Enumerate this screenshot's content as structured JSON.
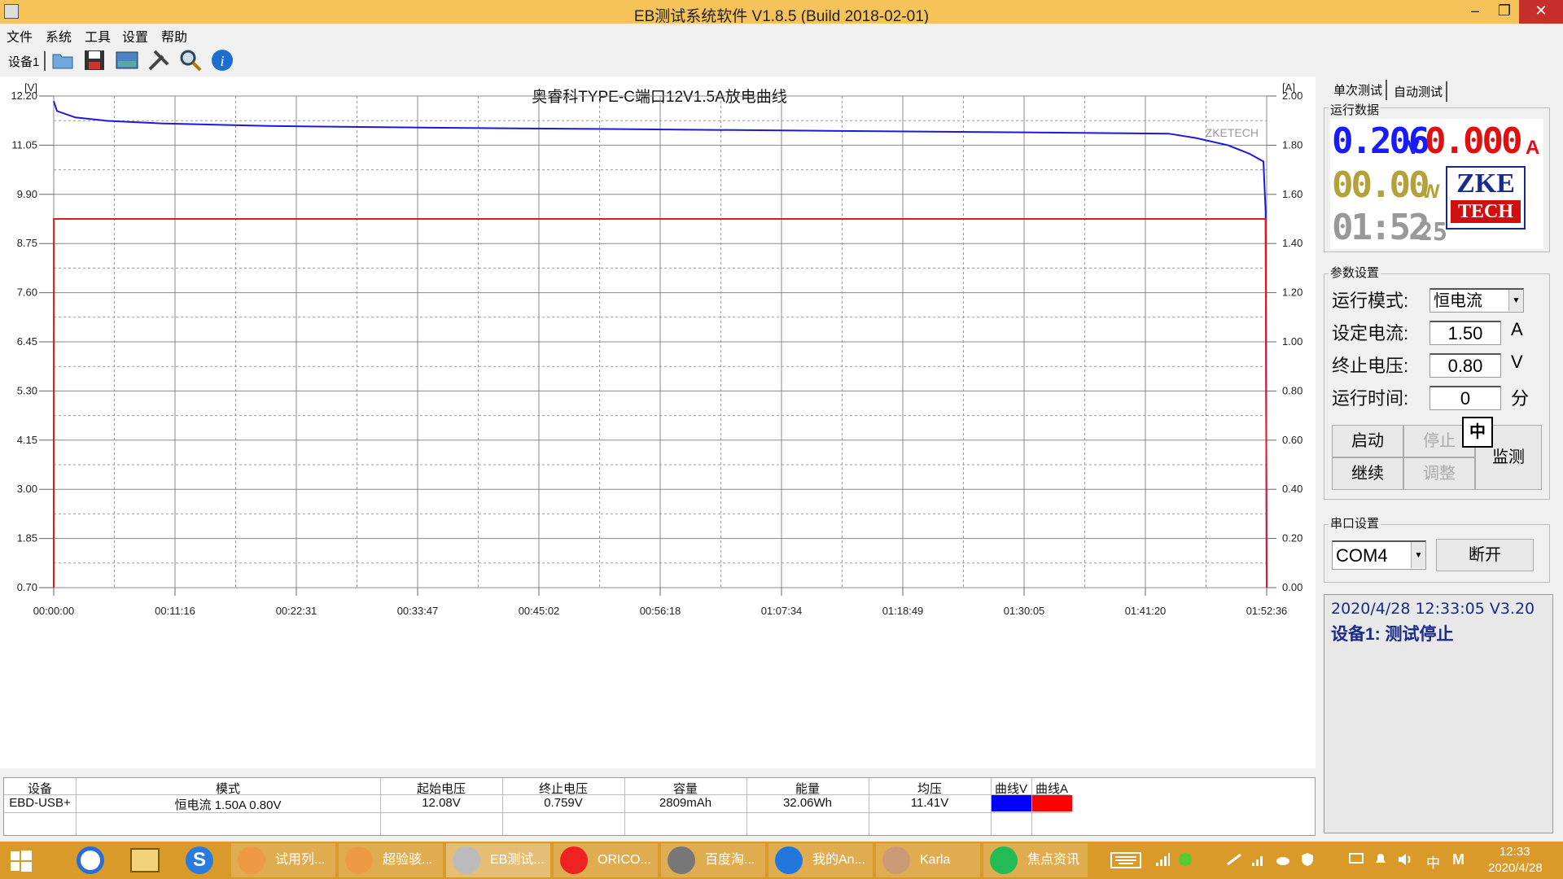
{
  "window": {
    "title": "EB测试系统软件 V1.8.5 (Build 2018-02-01)",
    "minimize": "–",
    "maximize": "❐",
    "close": "✕"
  },
  "menu": [
    "文件",
    "系统",
    "工具",
    "设置",
    "帮助"
  ],
  "toolbar": {
    "device_tab": "设备1",
    "icons": [
      "open-folder-icon",
      "save-icon",
      "image-icon",
      "tools-icon",
      "search-icon",
      "info-icon"
    ]
  },
  "chart_data": {
    "type": "line",
    "title": "奥睿科TYPE-C端口12V1.5A放电曲线",
    "watermark": "ZKETECH",
    "left_axis_unit": "[V]",
    "right_axis_unit": "[A]",
    "y_left_ticks": [
      "12.20",
      "11.05",
      "9.90",
      "8.75",
      "7.60",
      "6.45",
      "5.30",
      "4.15",
      "3.00",
      "1.85",
      "0.70"
    ],
    "y_right_ticks": [
      "2.00",
      "1.80",
      "1.60",
      "1.40",
      "1.20",
      "1.00",
      "0.80",
      "0.60",
      "0.40",
      "0.20",
      "0.00"
    ],
    "x_ticks": [
      "00:00:00",
      "00:11:16",
      "00:22:31",
      "00:33:47",
      "00:45:02",
      "00:56:18",
      "01:07:34",
      "01:18:49",
      "01:30:05",
      "01:41:20",
      "01:52:36"
    ],
    "ylim_left": [
      0.7,
      12.2
    ],
    "ylim_right": [
      0.0,
      2.0
    ],
    "x_range_min": [
      0,
      112.6
    ],
    "grid": true,
    "series": [
      {
        "name": "V",
        "color": "#1a1adc",
        "axis": "left",
        "x": [
          0,
          0.3,
          2,
          5,
          10,
          20,
          35,
          50,
          70,
          90,
          103.5,
          106,
          109,
          111,
          112.3,
          112.5,
          112.6
        ],
        "y": [
          12.08,
          11.85,
          11.7,
          11.62,
          11.56,
          11.5,
          11.46,
          11.43,
          11.39,
          11.35,
          11.32,
          11.22,
          11.05,
          10.85,
          10.67,
          9.5,
          0.72
        ]
      },
      {
        "name": "A",
        "color": "#e21a1a",
        "axis": "right",
        "x": [
          0,
          0.01,
          112.5,
          112.6
        ],
        "y": [
          0,
          1.5,
          1.5,
          0
        ]
      }
    ]
  },
  "table": {
    "headers": [
      "设备",
      "模式",
      "起始电压",
      "终止电压",
      "容量",
      "能量",
      "均压",
      "曲线V",
      "曲线A"
    ],
    "row": [
      "EBD-USB+",
      "恒电流 1.50A 0.80V",
      "12.08V",
      "0.759V",
      "2809mAh",
      "32.06Wh",
      "11.41V",
      "",
      ""
    ],
    "curve_v_color": "#0000ff",
    "curve_a_color": "#ff0000"
  },
  "panel": {
    "tabs": [
      "单次测试",
      "自动测试"
    ],
    "run_data_label": "运行数据",
    "voltage": "0.206",
    "voltage_unit": "V",
    "current": "0.000",
    "current_unit": "A",
    "power": "00.00",
    "power_unit": "W",
    "time": "01:52",
    "time_sec": "25",
    "logo_top": "ZKE",
    "logo_bottom": "TECH",
    "params_label": "参数设置",
    "mode_label": "运行模式:",
    "mode_value": "恒电流",
    "current_label": "设定电流:",
    "current_value": "1.50",
    "current_unit_label": "A",
    "end_v_label": "终止电压:",
    "end_v_value": "0.80",
    "end_v_unit": "V",
    "runtime_label": "运行时间:",
    "runtime_value": "0",
    "runtime_unit": "分",
    "start_btn": "启动",
    "stop_btn": "停止",
    "continue_btn": "继续",
    "adjust_btn": "调整",
    "monitor_btn": "监测",
    "ime_badge": "中",
    "serial_label": "串口设置",
    "port_value": "COM4",
    "disconnect_btn": "断开",
    "log_line1": "2020/4/28 12:33:05  V3.20",
    "log_line2": "设备1: 测试停止"
  },
  "taskbar": {
    "tasks": [
      "试用列...",
      "超验骇...",
      "EB测试...",
      "ORICO...",
      "百度淘...",
      "我的An...",
      "Karla",
      "焦点资讯"
    ],
    "time": "12:33",
    "date": "2020/4/28",
    "ime": "中",
    "lang": "M"
  }
}
